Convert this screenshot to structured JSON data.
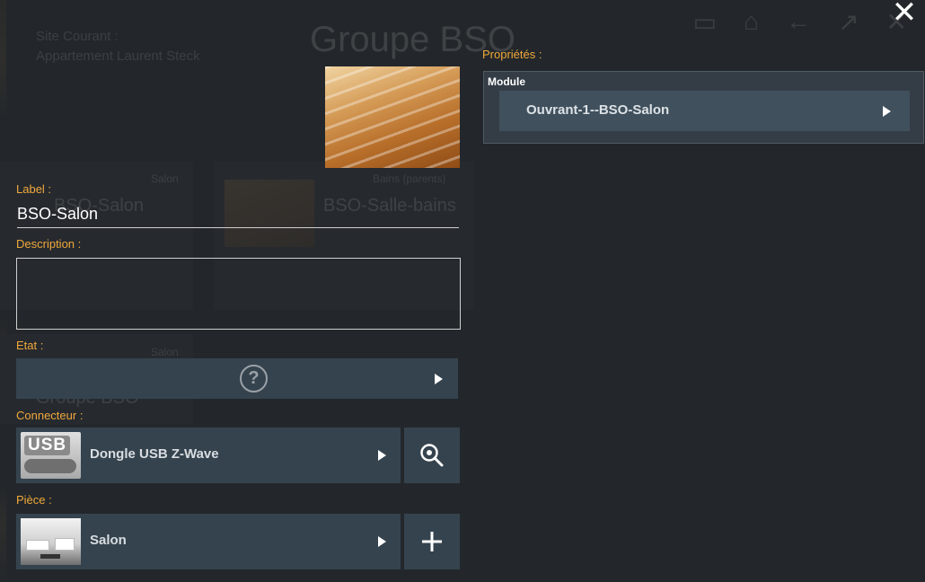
{
  "background": {
    "site_line1": "Site Courant :",
    "site_line2": "Appartement Laurent Steck",
    "page_title": "Groupe BSO",
    "cards": [
      {
        "room": "Salon",
        "name": "BSO-Salon"
      },
      {
        "room": "Bains (parents)",
        "name": "BSO-Salle-bains"
      },
      {
        "room": "Salon",
        "name": "Groupe BSO"
      }
    ]
  },
  "modal": {
    "close_icon": "close-icon",
    "label": {
      "caption": "Label :",
      "value": "BSO-Salon"
    },
    "description": {
      "caption": "Description :",
      "value": ""
    },
    "state": {
      "caption": "Etat :",
      "icon": "help-icon"
    },
    "connector": {
      "caption": "Connecteur :",
      "value": "Dongle USB Z-Wave",
      "thumb_text": "USB",
      "action_icon": "search-icon"
    },
    "room": {
      "caption": "Pièce :",
      "value": "Salon",
      "action_icon": "plus-icon"
    }
  },
  "properties": {
    "caption": "Propriétés :",
    "module_title": "Module",
    "module_value": "Ouvrant-1--BSO-Salon"
  },
  "colors": {
    "accent": "#f0a83a",
    "panel": "#35434e",
    "background": "#23272b"
  }
}
